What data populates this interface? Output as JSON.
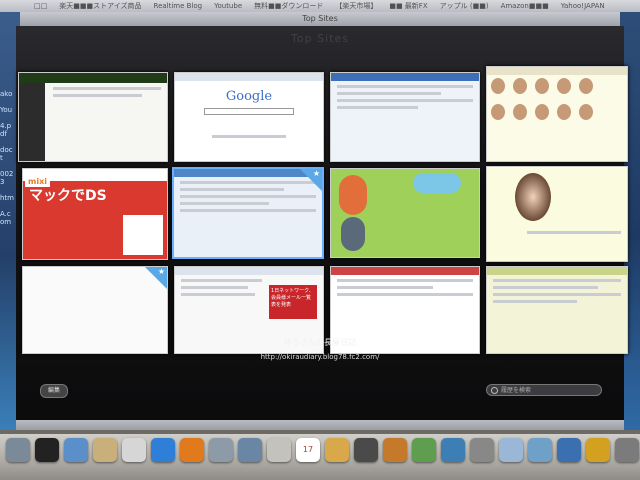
{
  "bookmarks_bar": {
    "items": [
      "□□",
      "楽天■■■ストアイズ商品",
      "Realtime Blog",
      "Youtube",
      "無料■■ダウンロード",
      "【楽天市場】",
      "■■ 最新FX",
      "アップル (■■)",
      "Amazon■■■",
      "Yahoo!JAPAN"
    ]
  },
  "window": {
    "title": "Top Sites",
    "header": "Top Sites"
  },
  "thumbnails": [
    {
      "id": "site-1"
    },
    {
      "id": "google",
      "logo": "Google"
    },
    {
      "id": "site-3"
    },
    {
      "id": "site-4"
    },
    {
      "id": "mixi",
      "logo": "mixi",
      "headline": "マックでDS"
    },
    {
      "id": "blog-selected"
    },
    {
      "id": "game-site"
    },
    {
      "id": "portrait-site"
    },
    {
      "id": "blank-site"
    },
    {
      "id": "blog-2",
      "banner": "1日ネットワーク、会員様メール一覧表を発表"
    },
    {
      "id": "site-11"
    },
    {
      "id": "site-12"
    }
  ],
  "caption": {
    "title": "ゆうさんの長屋日記",
    "url": "http://okiraudiary.blog78.fc2.com/"
  },
  "controls": {
    "edit_label": "編集",
    "search_placeholder": "履歴を検索"
  },
  "desktop": {
    "left_edge_text": "ako\nYou\n4.pdf\ndoct\n0023\nhtm\nA.com"
  },
  "dock": {
    "calendar_day": "17",
    "icon_colors": [
      "#7a8a99",
      "#222",
      "#5b8fc9",
      "#c9b07a",
      "#d6d6d6",
      "#2f7fd8",
      "#e07a1c",
      "#8d9aa8",
      "#6a86a5",
      "#c4c2bd",
      "#b8392f",
      "#d8a84a",
      "#4a4a4a",
      "#c47a2a",
      "#5f9d4f",
      "#3d7fb5",
      "#888",
      "#9bb7d8",
      "#6fa0c8",
      "#3a6fb0",
      "#d4a020",
      "#7b7b7b",
      "#2d6db0",
      "#7f8c99"
    ]
  }
}
